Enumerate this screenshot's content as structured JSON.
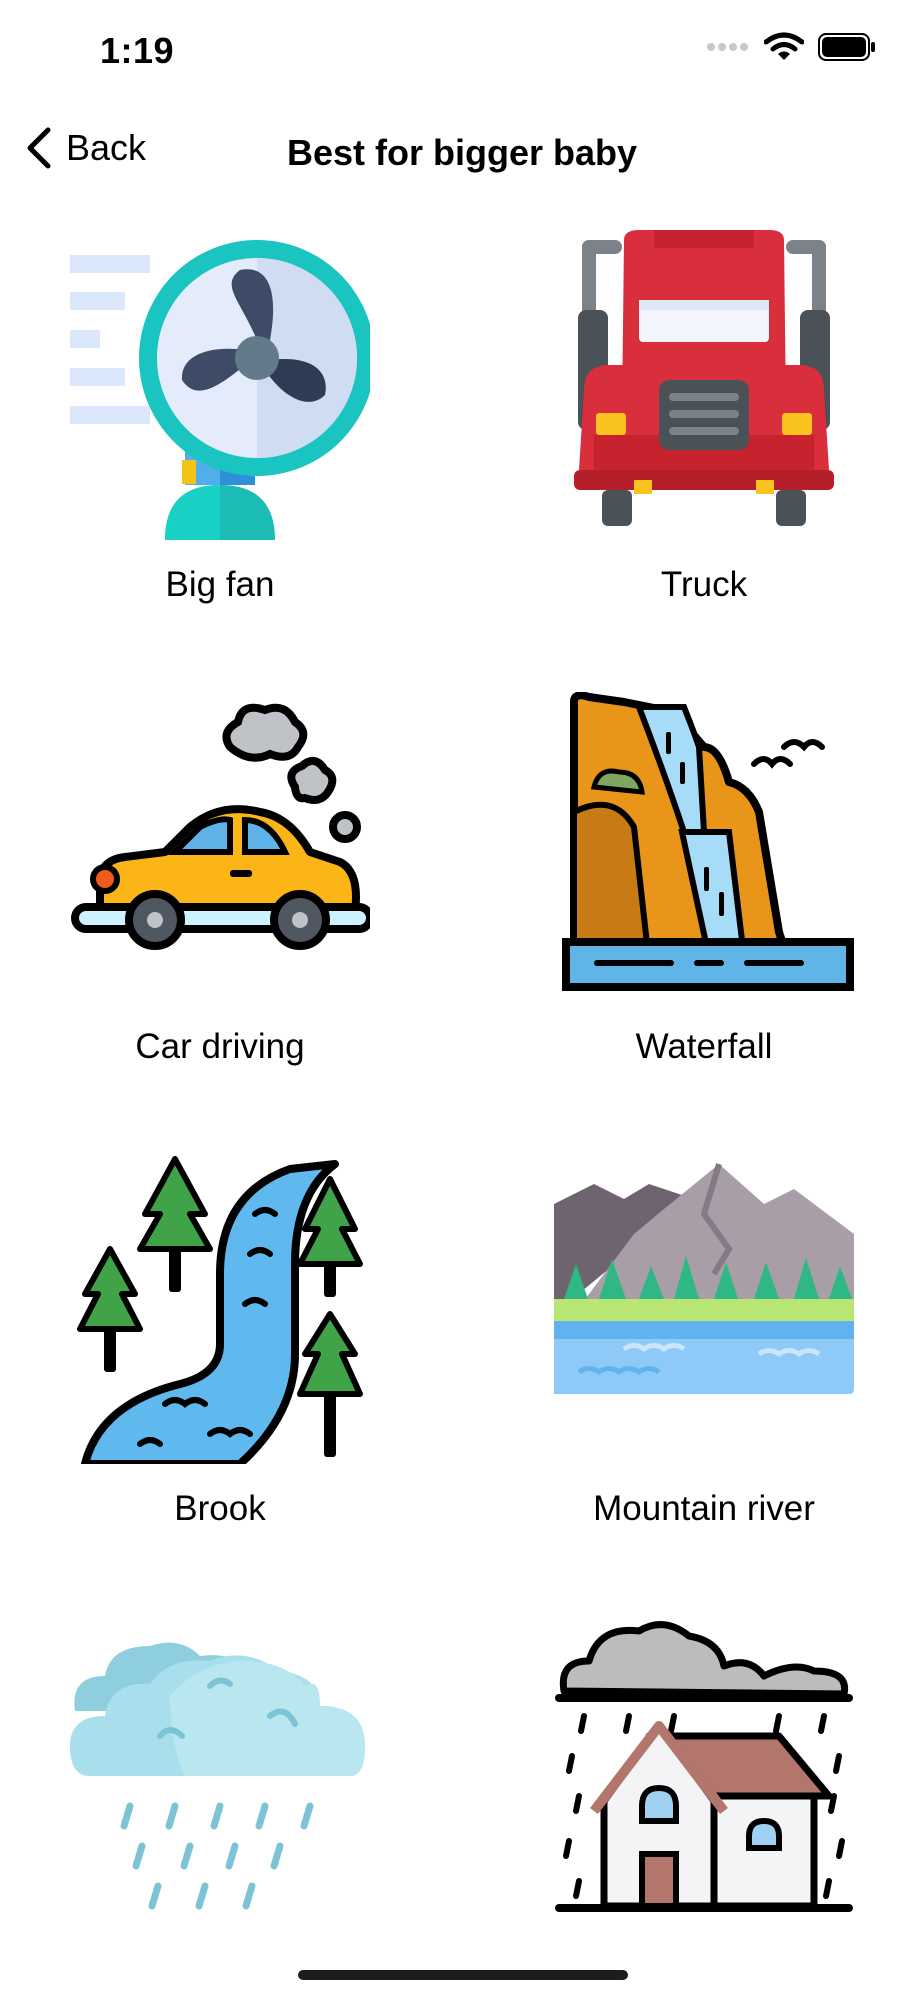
{
  "status_bar": {
    "time": "1:19",
    "signal_icon": "signal-dots-icon",
    "wifi_icon": "wifi-icon",
    "battery_icon": "battery-icon"
  },
  "nav": {
    "back_label": "Back",
    "back_icon": "chevron-left-icon",
    "title": "Best for bigger baby"
  },
  "sounds": [
    {
      "label": "Big fan",
      "icon": "fan-icon"
    },
    {
      "label": "Truck",
      "icon": "truck-icon"
    },
    {
      "label": "Car driving",
      "icon": "car-icon"
    },
    {
      "label": "Waterfall",
      "icon": "waterfall-icon"
    },
    {
      "label": "Brook",
      "icon": "brook-icon"
    },
    {
      "label": "Mountain river",
      "icon": "mountain-river-icon"
    },
    {
      "label": "",
      "icon": "rain-cloud-icon"
    },
    {
      "label": "",
      "icon": "rain-house-icon"
    }
  ]
}
